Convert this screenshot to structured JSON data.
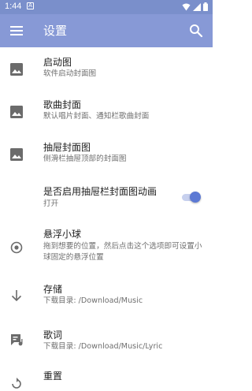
{
  "status_bar": {
    "time": "1:44",
    "notification_glyph": "A"
  },
  "app_bar": {
    "title": "设置",
    "menu_icon": "menu-icon",
    "search_icon": "search-icon"
  },
  "settings": [
    {
      "title": "启动图",
      "subtitle": "软件启动封面图",
      "icon": "image-icon"
    },
    {
      "title": "歌曲封面",
      "subtitle": "默认唱片封面、通知栏歌曲封面",
      "icon": "image-icon"
    },
    {
      "title": "抽屉封面图",
      "subtitle": "侧滑栏抽屉顶部的封面图",
      "icon": "image-icon"
    },
    {
      "title": "是否启用抽屉栏封面图动画",
      "subtitle": "打开",
      "switch_on": true
    },
    {
      "title": "悬浮小球",
      "subtitle": "拖到想要的位置，然后点击这个选项即可设置小球固定的悬浮位置",
      "icon": "radio-target-icon"
    },
    {
      "title": "存储",
      "subtitle": "下载目录: /Download/Music",
      "icon": "download-arrow-icon"
    },
    {
      "title": "歌词",
      "subtitle": "下载目录: /Download/Music/Lyric",
      "icon": "lyrics-icon"
    },
    {
      "title": "重置",
      "icon": "reset-icon"
    }
  ],
  "colors": {
    "status_bar": "#7a8fcb",
    "app_bar": "#8799d6",
    "accent": "#5c79d4"
  }
}
